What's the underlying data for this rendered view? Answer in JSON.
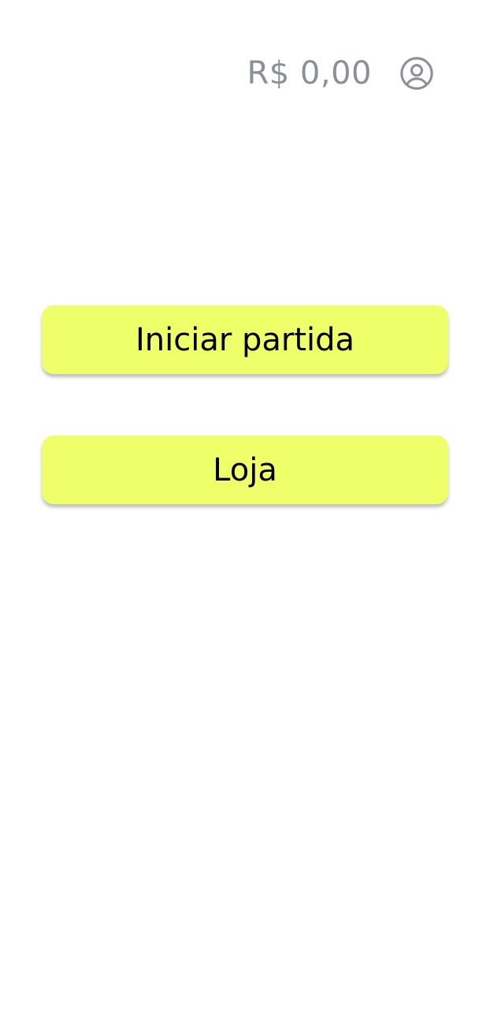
{
  "header": {
    "balance": "R$ 0,00",
    "profile_icon": "user-circle-icon"
  },
  "menu": {
    "start_match_label": "Iniciar partida",
    "shop_label": "Loja"
  },
  "colors": {
    "button_background": "#EFFF6A",
    "balance_text": "#8A9099",
    "button_text": "#000000",
    "background": "#FFFFFF"
  }
}
